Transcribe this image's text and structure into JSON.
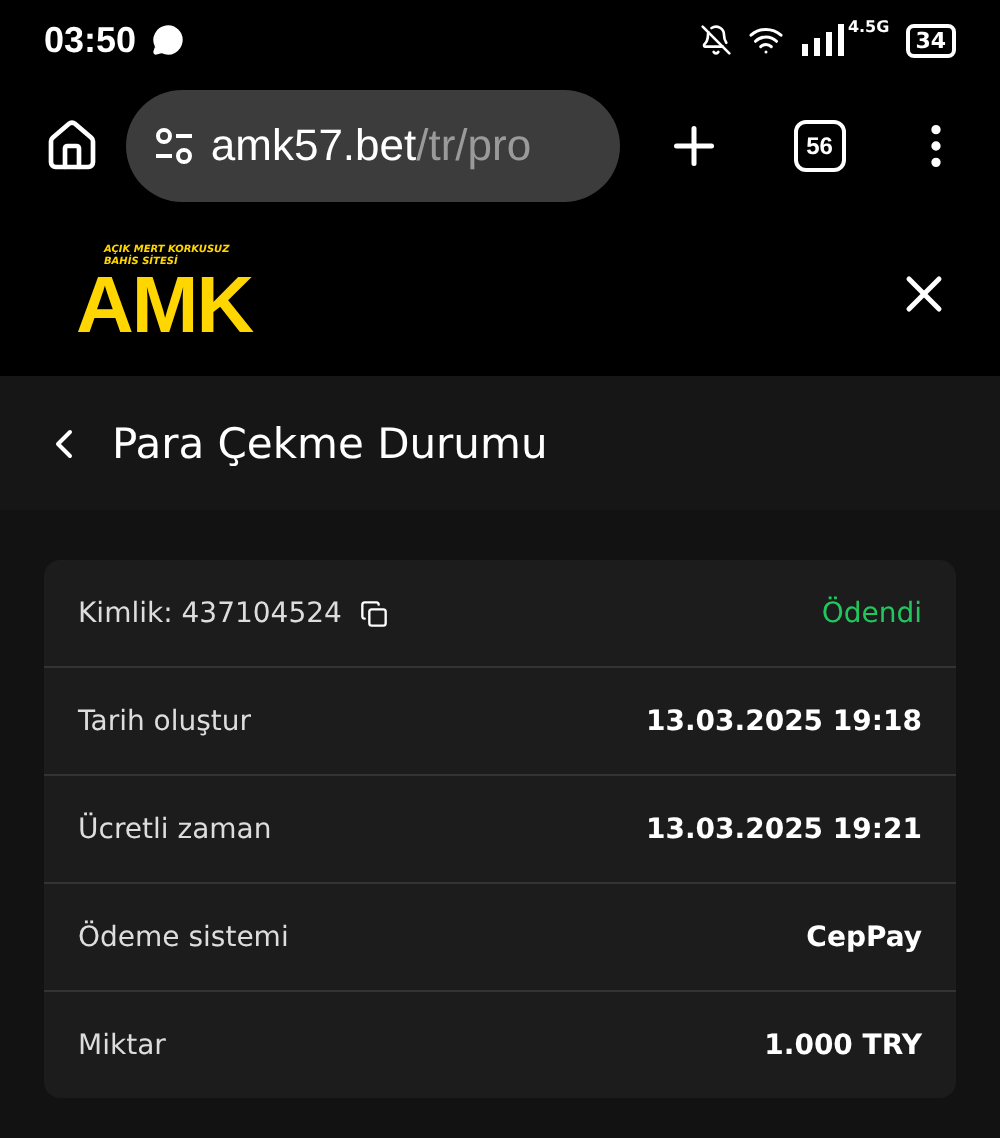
{
  "status_bar": {
    "time": "03:50",
    "network": "4.5G",
    "battery": "34"
  },
  "browser": {
    "url_host": "amk57.bet",
    "url_path": "/tr/pro",
    "tab_count": "56"
  },
  "site_header": {
    "logo_tagline": "AÇIK MERT KORKUSUZ BAHİS SİTESİ",
    "logo": "AMK"
  },
  "page_title": "Para Çekme Durumu",
  "details": [
    {
      "kind": "id",
      "label": "Kimlik: 437104524",
      "value": "Ödendi"
    },
    {
      "kind": "plain",
      "label": "Tarih oluştur",
      "value": "13.03.2025 19:18"
    },
    {
      "kind": "plain",
      "label": "Ücretli zaman",
      "value": "13.03.2025 19:21"
    },
    {
      "kind": "plain",
      "label": "Ödeme sistemi",
      "value": "CepPay"
    },
    {
      "kind": "plain",
      "label": "Miktar",
      "value": "1.000 TRY"
    }
  ]
}
